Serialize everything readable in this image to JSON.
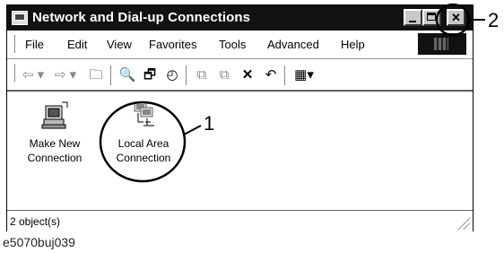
{
  "window": {
    "title": "Network and Dial-up Connections",
    "title_icon": "network-folder-icon"
  },
  "menubar": {
    "items": [
      "File",
      "Edit",
      "View",
      "Favorites",
      "Tools",
      "Advanced",
      "Help"
    ]
  },
  "toolbar": {
    "buttons": [
      {
        "name": "back-button",
        "glyph": "⇦ ▾"
      },
      {
        "name": "forward-button",
        "glyph": "⇨ ▾"
      },
      {
        "name": "up-folder-button",
        "glyph": "🗀"
      },
      {
        "name": "search-button",
        "glyph": "🔍"
      },
      {
        "name": "folders-button",
        "glyph": "🗗"
      },
      {
        "name": "history-button",
        "glyph": "◴"
      },
      {
        "name": "move-to-button",
        "glyph": "⧉"
      },
      {
        "name": "copy-to-button",
        "glyph": "⧉"
      },
      {
        "name": "delete-button",
        "glyph": "✕"
      },
      {
        "name": "undo-button",
        "glyph": "↶"
      },
      {
        "name": "views-button",
        "glyph": "▦▾"
      }
    ]
  },
  "icons": [
    {
      "label_line1": "Make New",
      "label_line2": "Connection",
      "icon": "make-new-connection-icon"
    },
    {
      "label_line1": "Local Area",
      "label_line2": "Connection",
      "icon": "local-area-connection-icon"
    }
  ],
  "status": {
    "text": "2 object(s)"
  },
  "caption": "e5070buj039",
  "callouts": {
    "one": "1",
    "two": "2"
  },
  "colors": {
    "titlebar": "#111111",
    "window_bg": "#ffffff",
    "frame": "#c8c8c8"
  }
}
